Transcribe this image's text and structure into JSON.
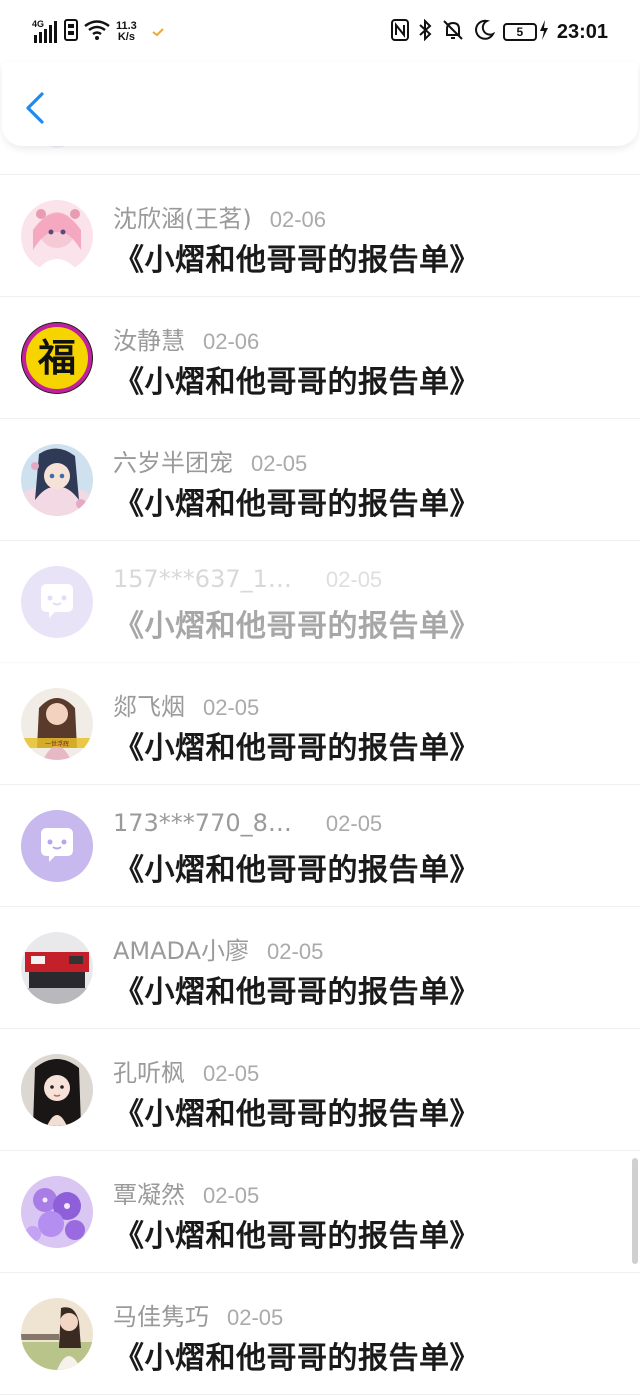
{
  "status_bar": {
    "network": "4G",
    "speed_value": "11.3",
    "speed_unit": "K/s",
    "battery": "5",
    "time": "23:01"
  },
  "header": {
    "back_icon": "chevron-left-icon"
  },
  "colors": {
    "accent": "#1e8bf0",
    "text_primary": "#1a1a1a",
    "text_secondary": "#9a9a9a"
  },
  "rows": [
    {
      "name": "沈欣涵(王茗)",
      "date": "02-06",
      "title": "《小熠和他哥哥的报告单》",
      "avatar": "anime-girl-pink-avatar"
    },
    {
      "name": "汝静慧",
      "date": "02-06",
      "title": "《小熠和他哥哥的报告单》",
      "avatar": "fu-character-avatar"
    },
    {
      "name": "六岁半团宠",
      "date": "02-05",
      "title": "《小熠和他哥哥的报告单》",
      "avatar": "anime-girl-blue-avatar"
    },
    {
      "name": "157***637_1…",
      "date": "02-05",
      "title": "《小熠和他哥哥的报告单》",
      "avatar": "default-chat-avatar"
    },
    {
      "name": "郯飞烟",
      "date": "02-05",
      "title": "《小熠和他哥哥的报告单》",
      "avatar": "girl-photo-avatar"
    },
    {
      "name": "173***770_8…",
      "date": "02-05",
      "title": "《小熠和他哥哥的报告单》",
      "avatar": "default-chat-avatar"
    },
    {
      "name": "AMADA小廖",
      "date": "02-05",
      "title": "《小熠和他哥哥的报告单》",
      "avatar": "machine-photo-avatar"
    },
    {
      "name": "孔听枫",
      "date": "02-05",
      "title": "《小熠和他哥哥的报告单》",
      "avatar": "girl-portrait-avatar"
    },
    {
      "name": "覃凝然",
      "date": "02-05",
      "title": "《小熠和他哥哥的报告单》",
      "avatar": "purple-flowers-avatar"
    },
    {
      "name": "马佳隽巧",
      "date": "02-05",
      "title": "《小熠和他哥哥的报告单》",
      "avatar": "girl-outdoor-avatar"
    }
  ]
}
